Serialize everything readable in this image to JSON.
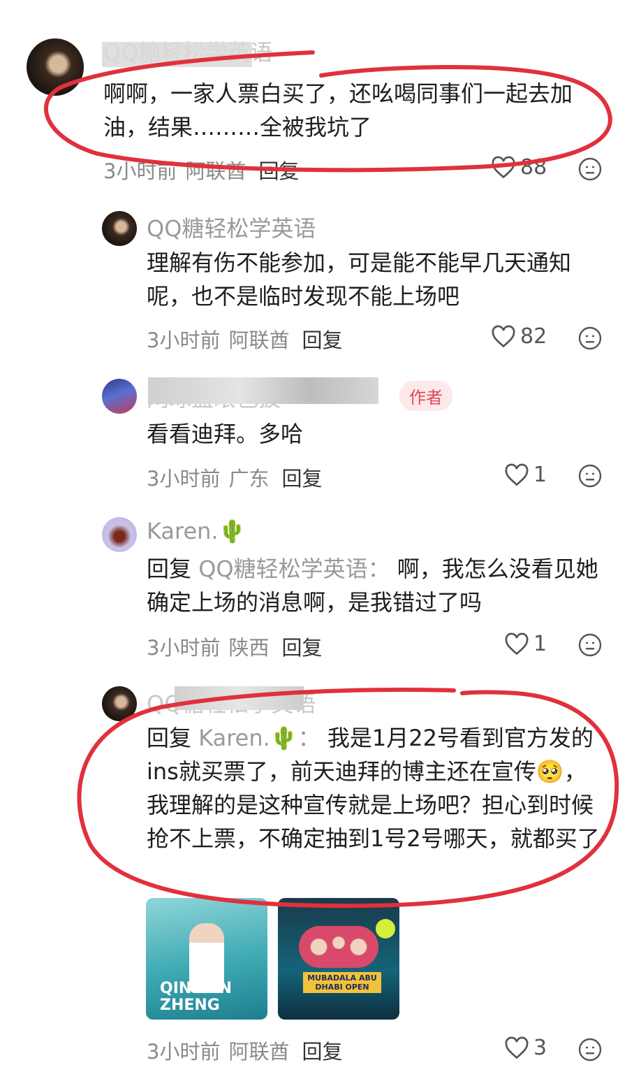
{
  "comments": [
    {
      "name": "QQ糖轻松学英语",
      "text": "啊啊，一家人票白买了，还吆喝同事们一起去加油，结果………全被我坑了",
      "time": "3小时前",
      "location": "阿联酋",
      "reply": "回复",
      "likes": "88"
    },
    {
      "name": "QQ糖轻松学英语",
      "text": "理解有伤不能参加，可是能不能早几天通知呢，也不是临时发现不能上场吧",
      "time": "3小时前",
      "location": "阿联酋",
      "reply": "回复",
      "likes": "82"
    },
    {
      "name": "网球蓝眼色披",
      "badge": "作者",
      "text": "看看迪拜。多哈",
      "time": "3小时前",
      "location": "广东",
      "reply": "回复",
      "likes": "1"
    },
    {
      "name": "Karen.🌵",
      "reply_prefix": "回复",
      "reply_to": "QQ糖轻松学英语：",
      "text": "啊，我怎么没看见她确定上场的消息啊，是我错过了吗",
      "time": "3小时前",
      "location": "陕西",
      "reply": "回复",
      "likes": "1"
    },
    {
      "name": "QQ糖轻松学英语",
      "reply_prefix": "回复",
      "reply_to": "Karen.🌵：",
      "text": "我是1月22号看到官方发的ins就买票了，前天迪拜的博主还在宣传🥺，我理解的是这种宣传就是上场吧？担心到时候抢不上票，不确定抽到1号2号哪天，就都买了",
      "images": [
        "QINWEN ZHENG",
        "MUBADALA ABU DHABI OPEN"
      ],
      "time": "3小时前",
      "location": "阿联酋",
      "reply": "回复",
      "likes": "3"
    }
  ],
  "colors": {
    "annotation": "#e0313c",
    "badge_bg": "#fde9e9",
    "badge_text": "#e0475b"
  }
}
